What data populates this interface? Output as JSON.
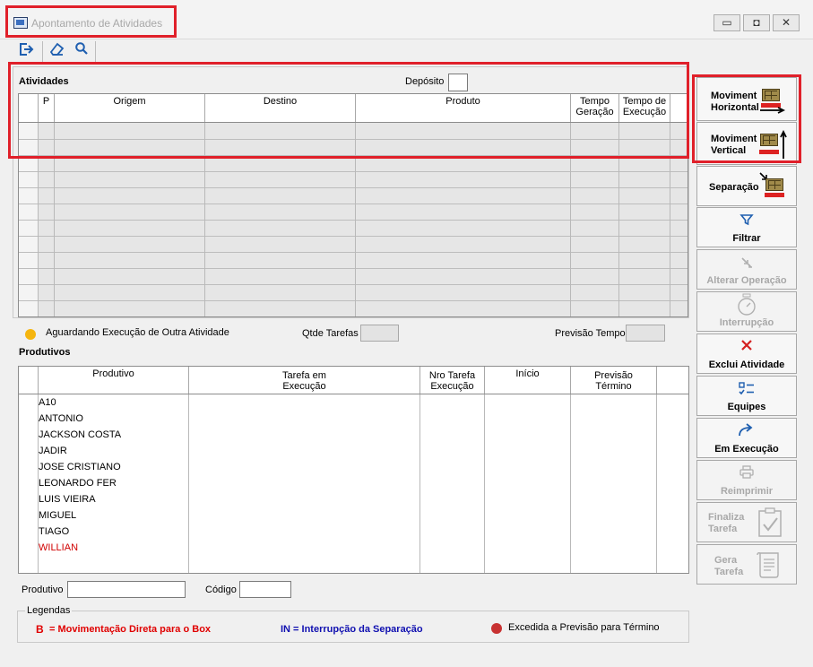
{
  "window": {
    "title": "Apontamento de Atividades",
    "min_glyph": "▭",
    "max_glyph": "◘",
    "close_glyph": "✕"
  },
  "toolbar": {
    "exit_icon": "exit-icon",
    "clear_icon": "eraser-icon",
    "search_icon": "search-icon"
  },
  "atividades": {
    "title": "Atividades",
    "deposito_label": "Depósito",
    "deposito_value": "",
    "columns": [
      "P",
      "Origem",
      "Destino",
      "Produto",
      "Tempo Geração",
      "Tempo de Execução"
    ],
    "col_p": "P",
    "col_origem": "Origem",
    "col_destino": "Destino",
    "col_produto": "Produto",
    "col_tempo_geracao_1": "Tempo",
    "col_tempo_geracao_2": "Geração",
    "col_tempo_exec_1": "Tempo de",
    "col_tempo_exec_2": "Execução"
  },
  "status": {
    "legend_dot_color": "#f5b50f",
    "aguardando_label": "Aguardando Execução de Outra Atividade",
    "qtde_tarefas_label": "Qtde Tarefas",
    "qtde_tarefas_value": "",
    "previsao_tempo_label": "Previsão Tempo",
    "previsao_tempo_value": ""
  },
  "produtivos": {
    "title": "Produtivos",
    "col_produtivo": "Produtivo",
    "col_tarefa_1": "Tarefa em",
    "col_tarefa_2": "Execução",
    "col_nro_1": "Nro Tarefa",
    "col_nro_2": "Execução",
    "col_inicio": "Início",
    "col_prev_1": "Previsão",
    "col_prev_2": "Término",
    "rows": [
      {
        "name": "A10",
        "color": "#000000"
      },
      {
        "name": "ANTONIO",
        "color": "#000000"
      },
      {
        "name": "JACKSON COSTA",
        "color": "#000000"
      },
      {
        "name": "JADIR",
        "color": "#000000"
      },
      {
        "name": "JOSE CRISTIANO",
        "color": "#000000"
      },
      {
        "name": "LEONARDO FER",
        "color": "#000000"
      },
      {
        "name": "LUIS VIEIRA",
        "color": "#000000"
      },
      {
        "name": "MIGUEL",
        "color": "#000000"
      },
      {
        "name": "TIAGO",
        "color": "#000000"
      },
      {
        "name": "WILLIAN",
        "color": "#d00000"
      }
    ]
  },
  "filters": {
    "produtivo_label": "Produtivo",
    "produtivo_value": "",
    "codigo_label": "Código",
    "codigo_value": ""
  },
  "legendas": {
    "title": "Legendas",
    "b_symbol": "B",
    "b_text": "= Movimentação Direta para o Box",
    "b_color": "#e00000",
    "in_text": "IN = Interrupção da Separação",
    "in_color": "#1010b0",
    "excedida_text": "Excedida a Previsão para Término",
    "excedida_color": "#c83232"
  },
  "side_buttons": {
    "mov_h_1": "Moviment",
    "mov_h_2": "Horizontal",
    "mov_v_1": "Moviment",
    "mov_v_2": "Vertical",
    "separacao": "Separação",
    "filtrar": "Filtrar",
    "alterar_operacao": "Alterar Operação",
    "interrupcao": "Interrupção",
    "exclui_atividade": "Exclui Atividade",
    "equipes": "Equipes",
    "em_execucao": "Em Execução",
    "reimprimir": "Reimprimir",
    "finaliza_1": "Finaliza",
    "finaliza_2": "Tarefa",
    "gera_1": "Gera",
    "gera_2": "Tarefa"
  },
  "colors": {
    "highlight": "#e0202a",
    "accent_blue": "#1f5fb0",
    "disabled": "#a8a8a8"
  }
}
